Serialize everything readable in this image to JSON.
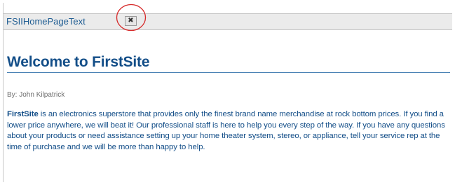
{
  "tab": {
    "label": "FSIIHomePageText",
    "close_glyph": "✖"
  },
  "article": {
    "heading": "Welcome to FirstSite",
    "byline": "By: John Kilpatrick",
    "brand": "FirstSite",
    "body": " is an electronics superstore that provides only the finest brand name merchandise at rock bottom prices. If you find a lower price anywhere, we will beat it! Our professional staff is here to help you every step of the way. If you have any questions about your products or need assistance setting up your home theater system, stereo, or appliance, tell your service rep at the time of purchase and we will be more than happy to help."
  },
  "colors": {
    "accent": "#134e88",
    "highlight": "#d62a2a"
  }
}
